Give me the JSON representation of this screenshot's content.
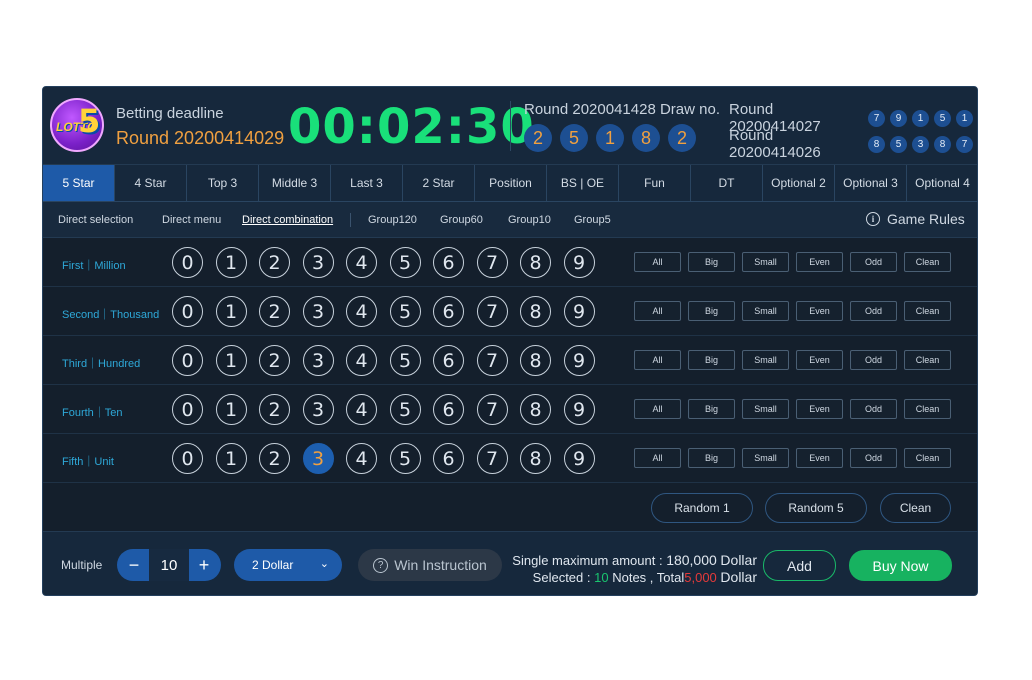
{
  "header": {
    "logo_text": "LOTTO 5",
    "deadline_label": "Betting deadline",
    "deadline_round": "Round 20200414029",
    "countdown": "00:02:30",
    "draw_label": "Round 2020041428 Draw no.",
    "draw_numbers": [
      "2",
      "5",
      "1",
      "8",
      "2"
    ],
    "history": [
      {
        "label": "Round 20200414027",
        "numbers": [
          "7",
          "9",
          "1",
          "5",
          "1"
        ]
      },
      {
        "label": "Round 20200414026",
        "numbers": [
          "8",
          "5",
          "3",
          "8",
          "7"
        ]
      }
    ]
  },
  "tabs": [
    "5 Star",
    "4 Star",
    "Top 3",
    "Middle 3",
    "Last 3",
    "2 Star",
    "Position",
    "BS | OE",
    "Fun",
    "DT",
    "Optional 2",
    "Optional 3",
    "Optional 4"
  ],
  "active_tab": "5 Star",
  "subtabs": [
    "Direct selection",
    "Direct menu",
    "Direct combination",
    "Group120",
    "Group60",
    "Group10",
    "Group5"
  ],
  "active_subtab": "Direct combination",
  "game_rules_label": "Game Rules",
  "digits": [
    "0",
    "1",
    "2",
    "3",
    "4",
    "5",
    "6",
    "7",
    "8",
    "9"
  ],
  "quick_buttons": [
    "All",
    "Big",
    "Small",
    "Even",
    "Odd",
    "Clean"
  ],
  "rows": [
    {
      "label": "First｜Million",
      "selected": []
    },
    {
      "label": "Second｜Thousand",
      "selected": []
    },
    {
      "label": "Third｜Hundred",
      "selected": []
    },
    {
      "label": "Fourth｜Ten",
      "selected": []
    },
    {
      "label": "Fifth｜Unit",
      "selected": [
        "3"
      ]
    }
  ],
  "random_buttons": {
    "random1": "Random 1",
    "random5": "Random 5",
    "clean": "Clean"
  },
  "bottom": {
    "multiple_label": "Multiple",
    "minus": "−",
    "plus": "+",
    "multiple_value": "10",
    "dollar_value": "2 Dollar",
    "win_instruction": "Win Instruction",
    "max_label": "Single maximum amount :",
    "max_value": "180,000",
    "currency": "Dollar",
    "selected_label": "Selected :",
    "selected_count": "10",
    "notes_total_label": "Notes , Total",
    "total_value": "5,000",
    "add_label": "Add",
    "buy_label": "Buy Now"
  },
  "colors": {
    "accent": "#1e5aa8",
    "countdown": "#19e07a",
    "highlight": "#f0a040",
    "buy": "#17b260"
  }
}
